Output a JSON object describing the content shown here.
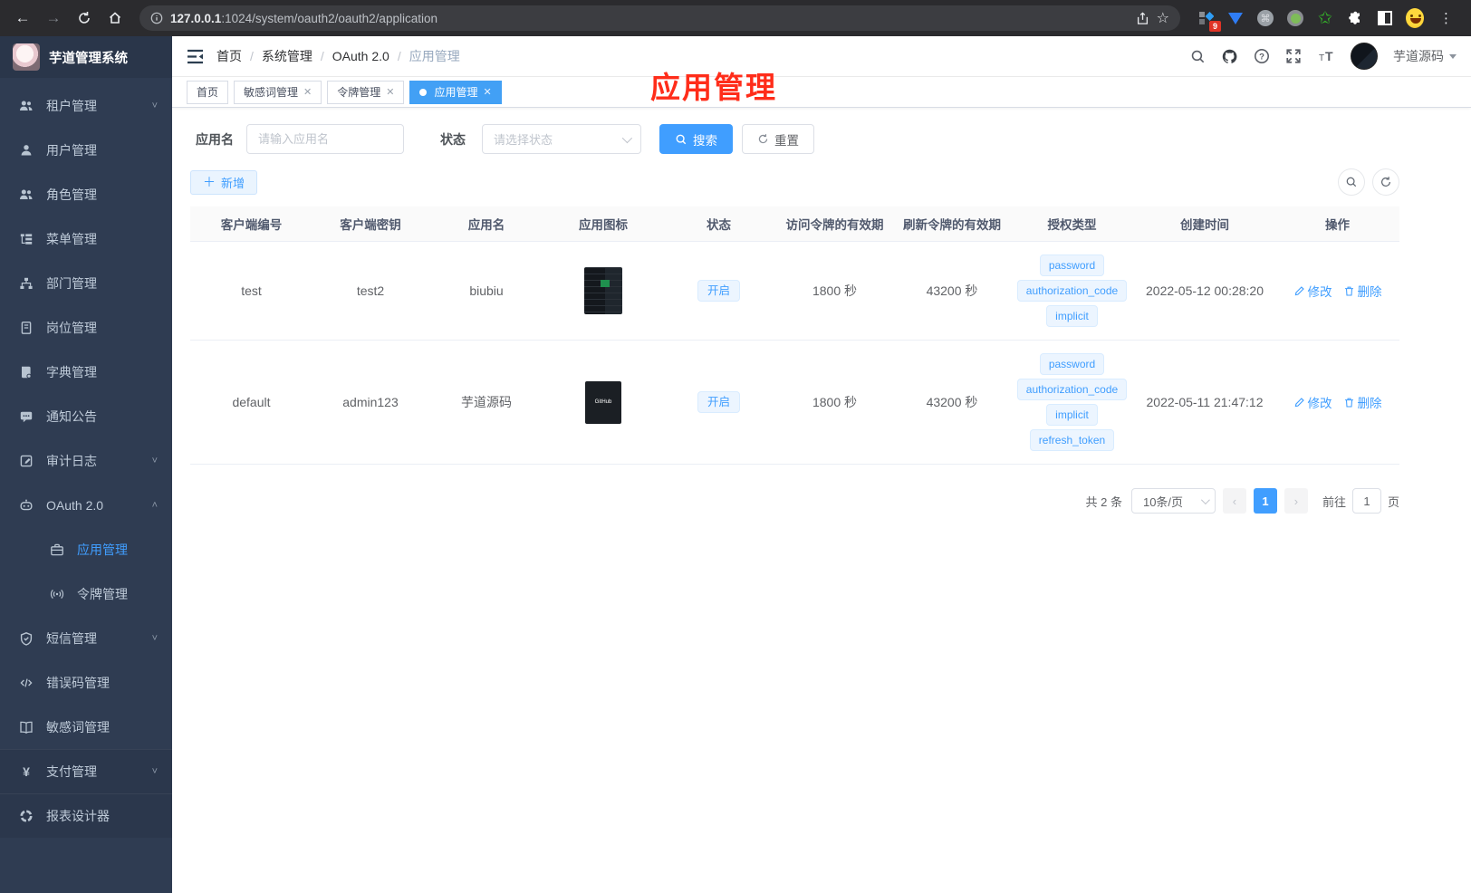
{
  "browser": {
    "url_host": "127.0.0.1",
    "url_rest": ":1024/system/oauth2/oauth2/application",
    "extension_badge": "9"
  },
  "sidebar": {
    "logo_title": "芋道管理系统",
    "items": [
      {
        "icon": "users-icon",
        "label": "租户管理",
        "chevron": "down"
      },
      {
        "icon": "user-icon",
        "label": "用户管理"
      },
      {
        "icon": "users-icon",
        "label": "角色管理"
      },
      {
        "icon": "menu-tree-icon",
        "label": "菜单管理"
      },
      {
        "icon": "org-icon",
        "label": "部门管理"
      },
      {
        "icon": "badge-icon",
        "label": "岗位管理"
      },
      {
        "icon": "dict-icon",
        "label": "字典管理"
      },
      {
        "icon": "message-icon",
        "label": "通知公告"
      },
      {
        "icon": "log-icon",
        "label": "审计日志",
        "chevron": "down"
      },
      {
        "icon": "robot-icon",
        "label": "OAuth 2.0",
        "chevron": "up"
      },
      {
        "icon": "briefcase-icon",
        "label": "应用管理",
        "sub": true,
        "active": true
      },
      {
        "icon": "signal-icon",
        "label": "令牌管理",
        "sub": true
      },
      {
        "icon": "shield-icon",
        "label": "短信管理",
        "chevron": "down"
      },
      {
        "icon": "code-icon",
        "label": "错误码管理"
      },
      {
        "icon": "book-icon",
        "label": "敏感词管理"
      },
      {
        "icon": "yen-icon",
        "label": "支付管理",
        "chevron": "down",
        "group2": true
      },
      {
        "icon": "pie-icon",
        "label": "报表设计器",
        "group2": true
      }
    ]
  },
  "header": {
    "breadcrumbs": [
      "首页",
      "系统管理",
      "OAuth 2.0",
      "应用管理"
    ],
    "username": "芋道源码"
  },
  "annotation": "应用管理",
  "tabs": [
    {
      "label": "首页",
      "closable": false,
      "active": false
    },
    {
      "label": "敏感词管理",
      "closable": true,
      "active": false
    },
    {
      "label": "令牌管理",
      "closable": true,
      "active": false
    },
    {
      "label": "应用管理",
      "closable": true,
      "active": true
    }
  ],
  "filters": {
    "name_label": "应用名",
    "name_placeholder": "请输入应用名",
    "status_label": "状态",
    "status_placeholder": "请选择状态",
    "search_label": "搜索",
    "reset_label": "重置"
  },
  "toolbar": {
    "add_label": "新增"
  },
  "table": {
    "columns": [
      "客户端编号",
      "客户端密钥",
      "应用名",
      "应用图标",
      "状态",
      "访问令牌的有效期",
      "刷新令牌的有效期",
      "授权类型",
      "创建时间",
      "操作"
    ],
    "edit_label": "修改",
    "delete_label": "删除",
    "rows": [
      {
        "client_id": "test",
        "secret": "test2",
        "name": "biubiu",
        "icon": "app-screenshot-thumbnail",
        "status": "开启",
        "access_ttl": "1800 秒",
        "refresh_ttl": "43200 秒",
        "grants": [
          "password",
          "authorization_code",
          "implicit"
        ],
        "created": "2022-05-12 00:28:20"
      },
      {
        "client_id": "default",
        "secret": "admin123",
        "name": "芋道源码",
        "icon": "github-thumbnail",
        "status": "开启",
        "access_ttl": "1800 秒",
        "refresh_ttl": "43200 秒",
        "grants": [
          "password",
          "authorization_code",
          "implicit",
          "refresh_token"
        ],
        "created": "2022-05-11 21:47:12"
      }
    ]
  },
  "pagination": {
    "total": "共 2 条",
    "page_size": "10条/页",
    "current_page": "1",
    "goto_label": "前往",
    "goto_value": "1",
    "page_suffix": "页"
  },
  "colors": {
    "accent": "#409eff",
    "sidebar_bg": "#2f3c52",
    "annotation_red": "#ff2d1a"
  }
}
